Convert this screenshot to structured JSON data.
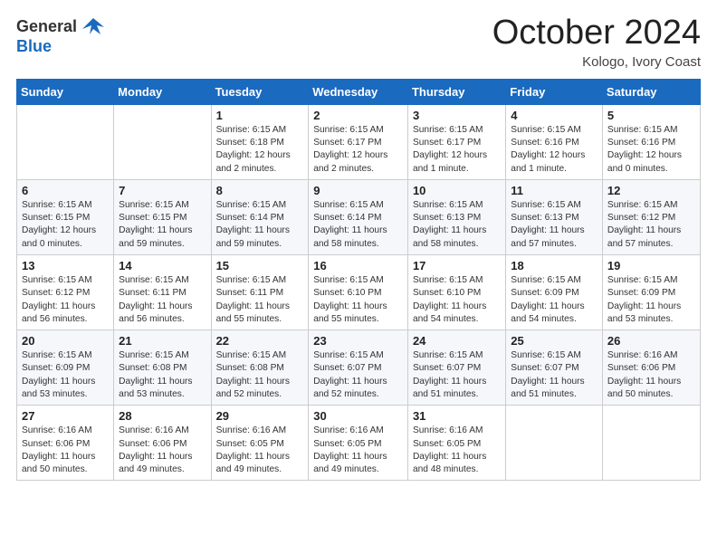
{
  "logo": {
    "general": "General",
    "blue": "Blue"
  },
  "header": {
    "month": "October 2024",
    "location": "Kologo, Ivory Coast"
  },
  "weekdays": [
    "Sunday",
    "Monday",
    "Tuesday",
    "Wednesday",
    "Thursday",
    "Friday",
    "Saturday"
  ],
  "weeks": [
    [
      {
        "day": "",
        "sunrise": "",
        "sunset": "",
        "daylight": ""
      },
      {
        "day": "",
        "sunrise": "",
        "sunset": "",
        "daylight": ""
      },
      {
        "day": "1",
        "sunrise": "Sunrise: 6:15 AM",
        "sunset": "Sunset: 6:18 PM",
        "daylight": "Daylight: 12 hours and 2 minutes."
      },
      {
        "day": "2",
        "sunrise": "Sunrise: 6:15 AM",
        "sunset": "Sunset: 6:17 PM",
        "daylight": "Daylight: 12 hours and 2 minutes."
      },
      {
        "day": "3",
        "sunrise": "Sunrise: 6:15 AM",
        "sunset": "Sunset: 6:17 PM",
        "daylight": "Daylight: 12 hours and 1 minute."
      },
      {
        "day": "4",
        "sunrise": "Sunrise: 6:15 AM",
        "sunset": "Sunset: 6:16 PM",
        "daylight": "Daylight: 12 hours and 1 minute."
      },
      {
        "day": "5",
        "sunrise": "Sunrise: 6:15 AM",
        "sunset": "Sunset: 6:16 PM",
        "daylight": "Daylight: 12 hours and 0 minutes."
      }
    ],
    [
      {
        "day": "6",
        "sunrise": "Sunrise: 6:15 AM",
        "sunset": "Sunset: 6:15 PM",
        "daylight": "Daylight: 12 hours and 0 minutes."
      },
      {
        "day": "7",
        "sunrise": "Sunrise: 6:15 AM",
        "sunset": "Sunset: 6:15 PM",
        "daylight": "Daylight: 11 hours and 59 minutes."
      },
      {
        "day": "8",
        "sunrise": "Sunrise: 6:15 AM",
        "sunset": "Sunset: 6:14 PM",
        "daylight": "Daylight: 11 hours and 59 minutes."
      },
      {
        "day": "9",
        "sunrise": "Sunrise: 6:15 AM",
        "sunset": "Sunset: 6:14 PM",
        "daylight": "Daylight: 11 hours and 58 minutes."
      },
      {
        "day": "10",
        "sunrise": "Sunrise: 6:15 AM",
        "sunset": "Sunset: 6:13 PM",
        "daylight": "Daylight: 11 hours and 58 minutes."
      },
      {
        "day": "11",
        "sunrise": "Sunrise: 6:15 AM",
        "sunset": "Sunset: 6:13 PM",
        "daylight": "Daylight: 11 hours and 57 minutes."
      },
      {
        "day": "12",
        "sunrise": "Sunrise: 6:15 AM",
        "sunset": "Sunset: 6:12 PM",
        "daylight": "Daylight: 11 hours and 57 minutes."
      }
    ],
    [
      {
        "day": "13",
        "sunrise": "Sunrise: 6:15 AM",
        "sunset": "Sunset: 6:12 PM",
        "daylight": "Daylight: 11 hours and 56 minutes."
      },
      {
        "day": "14",
        "sunrise": "Sunrise: 6:15 AM",
        "sunset": "Sunset: 6:11 PM",
        "daylight": "Daylight: 11 hours and 56 minutes."
      },
      {
        "day": "15",
        "sunrise": "Sunrise: 6:15 AM",
        "sunset": "Sunset: 6:11 PM",
        "daylight": "Daylight: 11 hours and 55 minutes."
      },
      {
        "day": "16",
        "sunrise": "Sunrise: 6:15 AM",
        "sunset": "Sunset: 6:10 PM",
        "daylight": "Daylight: 11 hours and 55 minutes."
      },
      {
        "day": "17",
        "sunrise": "Sunrise: 6:15 AM",
        "sunset": "Sunset: 6:10 PM",
        "daylight": "Daylight: 11 hours and 54 minutes."
      },
      {
        "day": "18",
        "sunrise": "Sunrise: 6:15 AM",
        "sunset": "Sunset: 6:09 PM",
        "daylight": "Daylight: 11 hours and 54 minutes."
      },
      {
        "day": "19",
        "sunrise": "Sunrise: 6:15 AM",
        "sunset": "Sunset: 6:09 PM",
        "daylight": "Daylight: 11 hours and 53 minutes."
      }
    ],
    [
      {
        "day": "20",
        "sunrise": "Sunrise: 6:15 AM",
        "sunset": "Sunset: 6:09 PM",
        "daylight": "Daylight: 11 hours and 53 minutes."
      },
      {
        "day": "21",
        "sunrise": "Sunrise: 6:15 AM",
        "sunset": "Sunset: 6:08 PM",
        "daylight": "Daylight: 11 hours and 53 minutes."
      },
      {
        "day": "22",
        "sunrise": "Sunrise: 6:15 AM",
        "sunset": "Sunset: 6:08 PM",
        "daylight": "Daylight: 11 hours and 52 minutes."
      },
      {
        "day": "23",
        "sunrise": "Sunrise: 6:15 AM",
        "sunset": "Sunset: 6:07 PM",
        "daylight": "Daylight: 11 hours and 52 minutes."
      },
      {
        "day": "24",
        "sunrise": "Sunrise: 6:15 AM",
        "sunset": "Sunset: 6:07 PM",
        "daylight": "Daylight: 11 hours and 51 minutes."
      },
      {
        "day": "25",
        "sunrise": "Sunrise: 6:15 AM",
        "sunset": "Sunset: 6:07 PM",
        "daylight": "Daylight: 11 hours and 51 minutes."
      },
      {
        "day": "26",
        "sunrise": "Sunrise: 6:16 AM",
        "sunset": "Sunset: 6:06 PM",
        "daylight": "Daylight: 11 hours and 50 minutes."
      }
    ],
    [
      {
        "day": "27",
        "sunrise": "Sunrise: 6:16 AM",
        "sunset": "Sunset: 6:06 PM",
        "daylight": "Daylight: 11 hours and 50 minutes."
      },
      {
        "day": "28",
        "sunrise": "Sunrise: 6:16 AM",
        "sunset": "Sunset: 6:06 PM",
        "daylight": "Daylight: 11 hours and 49 minutes."
      },
      {
        "day": "29",
        "sunrise": "Sunrise: 6:16 AM",
        "sunset": "Sunset: 6:05 PM",
        "daylight": "Daylight: 11 hours and 49 minutes."
      },
      {
        "day": "30",
        "sunrise": "Sunrise: 6:16 AM",
        "sunset": "Sunset: 6:05 PM",
        "daylight": "Daylight: 11 hours and 49 minutes."
      },
      {
        "day": "31",
        "sunrise": "Sunrise: 6:16 AM",
        "sunset": "Sunset: 6:05 PM",
        "daylight": "Daylight: 11 hours and 48 minutes."
      },
      {
        "day": "",
        "sunrise": "",
        "sunset": "",
        "daylight": ""
      },
      {
        "day": "",
        "sunrise": "",
        "sunset": "",
        "daylight": ""
      }
    ]
  ]
}
